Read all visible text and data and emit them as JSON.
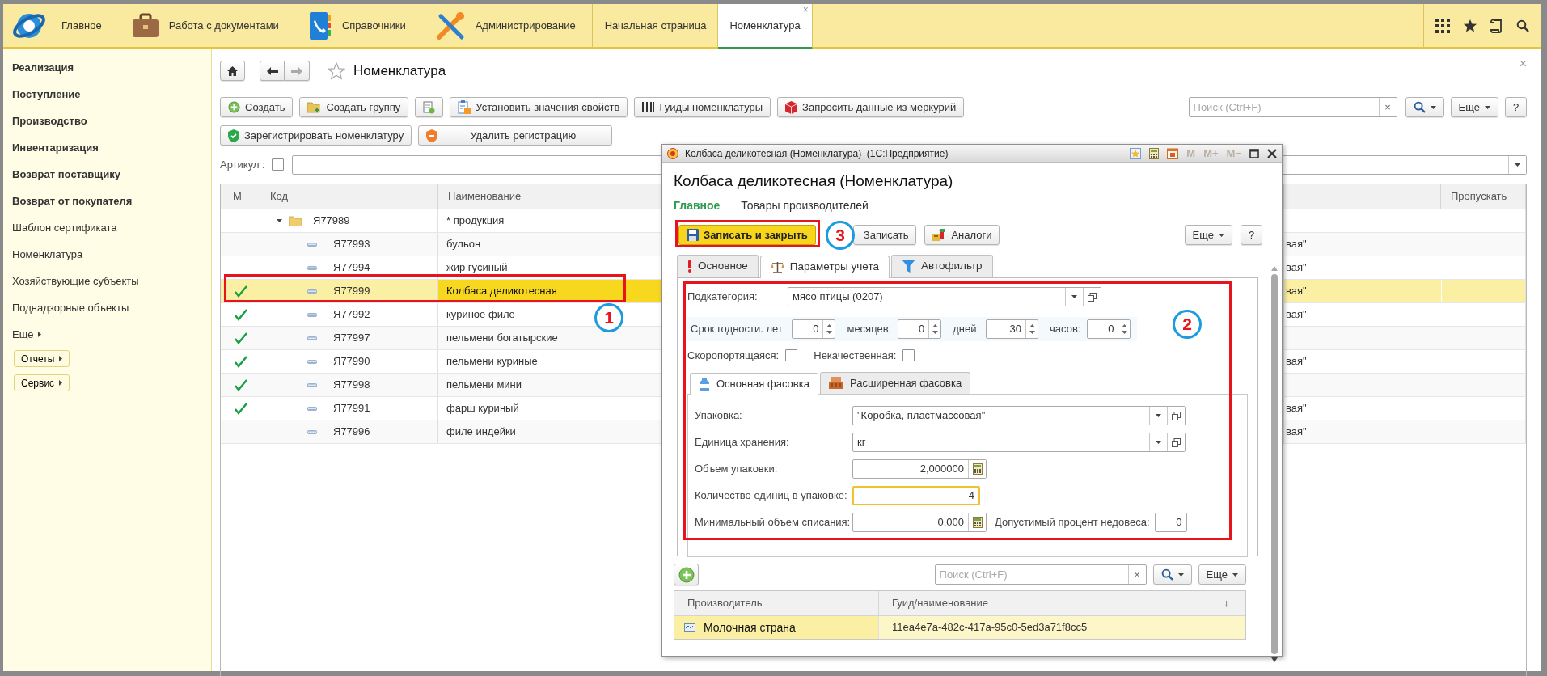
{
  "top_nav": {
    "sections": [
      {
        "kind": "logo",
        "label": "Главное"
      },
      {
        "kind": "briefcase",
        "label": "Работа с документами"
      },
      {
        "kind": "book",
        "label": "Справочники"
      },
      {
        "kind": "tools",
        "label": "Администрирование"
      }
    ],
    "open_tabs": [
      {
        "label": "Начальная страница",
        "selected": false
      },
      {
        "label": "Номенклатура",
        "selected": true,
        "close": "×"
      }
    ]
  },
  "sidebar": {
    "items": [
      {
        "kind": "group",
        "label": "Реализация"
      },
      {
        "kind": "group",
        "label": "Поступление"
      },
      {
        "kind": "group",
        "label": "Производство"
      },
      {
        "kind": "group",
        "label": "Инвентаризация"
      },
      {
        "kind": "group",
        "label": "Возврат поставщику"
      },
      {
        "kind": "group",
        "label": "Возврат от покупателя"
      },
      {
        "kind": "link",
        "label": "Шаблон сертификата"
      },
      {
        "kind": "link",
        "label": "Номенклатура"
      },
      {
        "kind": "link",
        "label": "Хозяйствующие субъекты"
      },
      {
        "kind": "link",
        "label": "Поднадзорные объекты"
      },
      {
        "kind": "more",
        "label": "Еще"
      },
      {
        "kind": "button",
        "label": "Отчеты"
      },
      {
        "kind": "button",
        "label": "Сервис"
      }
    ]
  },
  "page": {
    "title": "Номенклатура",
    "favorite": false,
    "close": "×",
    "toolbar_rows": [
      [
        {
          "kind": "create",
          "label": "Создать"
        },
        {
          "kind": "folder",
          "label": "Создать группу"
        },
        {
          "kind": "copy"
        },
        {
          "kind": "properties",
          "label": "Установить значения свойств"
        },
        {
          "kind": "barcode",
          "label": "Гуиды номенклатуры"
        },
        {
          "kind": "cube",
          "label": "Запросить данные из меркурий"
        }
      ],
      [
        {
          "kind": "shield",
          "label": "Зарегистрировать номенклатуру"
        },
        {
          "kind": "unshield",
          "label": "Удалить регистрацию"
        }
      ]
    ],
    "search": {
      "placeholder": "Поиск (Ctrl+F)",
      "clear": "×"
    },
    "more": "Еще",
    "help": "?",
    "filter": {
      "label": "Артикул :",
      "checked": false
    },
    "table": {
      "columns": [
        {
          "label": "М"
        },
        {
          "label": "Код"
        },
        {
          "label": "Наименование"
        },
        {
          "label": "Пропускать"
        }
      ],
      "rows": [
        {
          "kind": "group",
          "expanded": true,
          "marked": false,
          "selected": false,
          "code": "Я77989",
          "name": "* продукция",
          "children": [
            {
              "kind": "item",
              "marked": false,
              "selected": false,
              "code": "Я77993",
              "name": "бульон",
              "column_4": "вая\""
            },
            {
              "kind": "item",
              "marked": false,
              "selected": false,
              "code": "Я77994",
              "name": "жир гусиный",
              "column_4": "вая\""
            },
            {
              "kind": "item",
              "marked": true,
              "selected": true,
              "code": "Я77999",
              "name": "Колбаса деликотесная",
              "column_4": "вая\""
            },
            {
              "kind": "item",
              "marked": true,
              "selected": false,
              "code": "Я77992",
              "name": "куриное филе",
              "column_4": "вая\""
            },
            {
              "kind": "item",
              "marked": true,
              "selected": false,
              "code": "Я77997",
              "name": "пельмени богатырские"
            },
            {
              "kind": "item",
              "marked": true,
              "selected": false,
              "code": "Я77990",
              "name": "пельмени куриные",
              "column_4": "вая\""
            },
            {
              "kind": "item",
              "marked": true,
              "selected": false,
              "code": "Я77998",
              "name": "пельмени мини"
            },
            {
              "kind": "item",
              "marked": true,
              "selected": false,
              "code": "Я77991",
              "name": "фарш куриный",
              "column_4": "вая\""
            },
            {
              "kind": "item",
              "marked": false,
              "selected": false,
              "code": "Я77996",
              "name": "филе индейки",
              "column_4": "вая\""
            }
          ]
        }
      ]
    }
  },
  "form": {
    "window_title": "Колбаса деликотесная (Номенклатура)  (1С:Предприятие)",
    "memory_buttons": [
      {
        "label": "M",
        "disabled": true
      },
      {
        "label": "M+",
        "disabled": true
      },
      {
        "label": "M−",
        "disabled": true
      }
    ],
    "heading": "Колбаса деликотесная (Номенклатура)",
    "nav": [
      {
        "label": "Главное",
        "selected": true
      },
      {
        "label": "Товары производителей",
        "selected": false
      }
    ],
    "commands": [
      {
        "kind": "save_close",
        "label": "Записать и закрыть",
        "default": true
      },
      {
        "kind": "save",
        "label": "Записать",
        "default": false
      },
      {
        "kind": "analogs",
        "label": "Аналоги",
        "default": false
      }
    ],
    "more": "Еще",
    "help": "?",
    "tabs": [
      {
        "kind": "warning",
        "label": "Основное",
        "selected": false
      },
      {
        "kind": "scales",
        "label": "Параметры учета",
        "selected": true
      },
      {
        "kind": "filter",
        "label": "Автофильтр",
        "selected": false
      }
    ],
    "subcategory": {
      "label": "Подкатегория:",
      "value": "мясо птицы (0207)"
    },
    "shelf_life": [
      {
        "label": "Срок годности. лет:",
        "value": "0"
      },
      {
        "label": "месяцев:",
        "value": "0"
      },
      {
        "label": "дней:",
        "value": "30"
      },
      {
        "label": "часов:",
        "value": "0"
      }
    ],
    "flags": [
      {
        "label": "Скоропортящаяся:",
        "checked": false
      },
      {
        "label": "Некачественная:",
        "checked": false
      }
    ],
    "packing_tabs": [
      {
        "kind": "bottle",
        "label": "Основная фасовка",
        "selected": true
      },
      {
        "kind": "crate",
        "label": "Расширенная фасовка",
        "selected": false
      }
    ],
    "packing_fields": [
      {
        "kind": "select",
        "label": "Упаковка:",
        "value": "\"Коробка, пластмассовая\"",
        "focused": false
      },
      {
        "kind": "select",
        "label": "Единица хранения:",
        "value": "кг",
        "focused": false
      },
      {
        "kind": "calc",
        "label": "Объем упаковки:",
        "value": "2,000000",
        "focused": false
      },
      {
        "kind": "number",
        "label": "Количество единиц в упаковке:",
        "value": "4",
        "focused": true
      },
      {
        "kind": "calc",
        "label": "Минимальный объем списания:",
        "value": "0,000",
        "focused": false,
        "extra": {
          "label": "Допустимый процент недовеса:",
          "value": "0"
        }
      }
    ],
    "producers": {
      "search": {
        "placeholder": "Поиск (Ctrl+F)",
        "clear": "×"
      },
      "more": "Еще",
      "columns": [
        {
          "label": "Производитель"
        },
        {
          "label": "Гуид/наименование",
          "sort": "↓"
        }
      ],
      "rows": [
        {
          "producer": "Молочная страна",
          "guid": "11ea4e7a-482c-417a-95c0-5ed3a71f8cc5",
          "selected": true
        }
      ]
    }
  },
  "annotations": [
    {
      "label": "1"
    },
    {
      "label": "2"
    },
    {
      "label": "3"
    }
  ]
}
